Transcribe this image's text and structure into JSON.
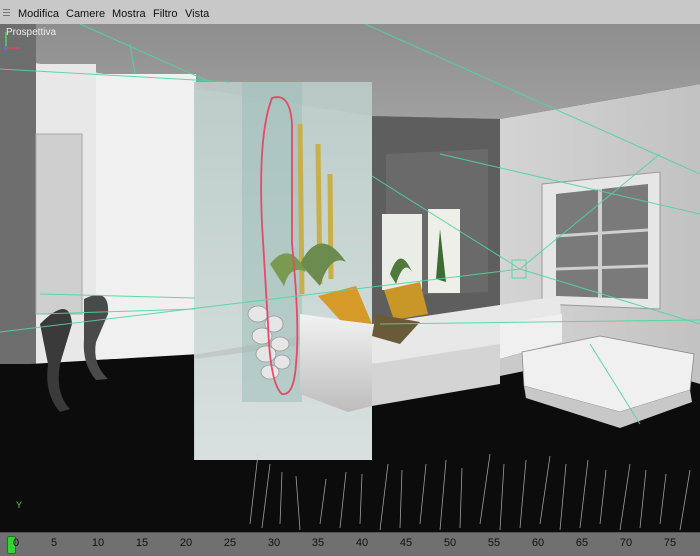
{
  "menu": {
    "items": [
      {
        "label": "Modifica"
      },
      {
        "label": "Camere"
      },
      {
        "label": "Mostra"
      },
      {
        "label": "Filtro"
      },
      {
        "label": "Vista"
      }
    ]
  },
  "viewport": {
    "label": "Prospettiva",
    "gizmo_label": "Y"
  },
  "timeline": {
    "ticks": [
      "0",
      "5",
      "10",
      "15",
      "20",
      "25",
      "30",
      "35",
      "40",
      "45",
      "50",
      "55",
      "60",
      "65",
      "70",
      "75"
    ],
    "current_frame": "0"
  },
  "colors": {
    "menubar": "#c8c8c8",
    "viewport_bg": "#0c0c0c",
    "guide_lines": "#4fd6a0",
    "annotation": "#e8486a",
    "frame_marker": "#33d433"
  }
}
